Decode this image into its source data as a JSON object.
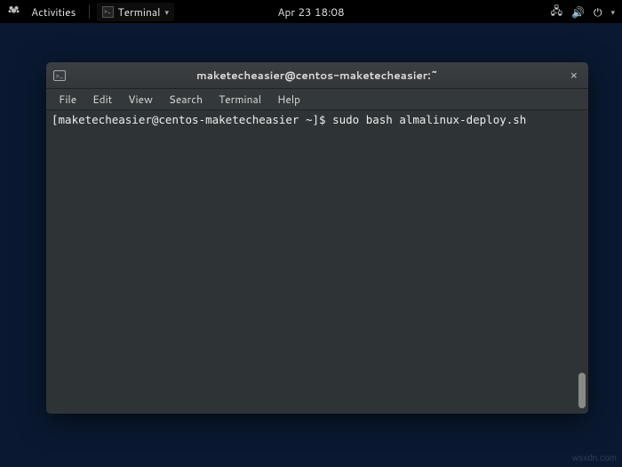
{
  "topbar": {
    "activities": "Activities",
    "app_name": "Terminal",
    "datetime": "Apr 23  18:08"
  },
  "icons": {
    "network": "🖧",
    "volume": "🔊",
    "power": "⏻",
    "dropdown": "▾",
    "terminal_prompt": ">_"
  },
  "window": {
    "title": "maketecheasier@centos-maketecheasier:~",
    "close_label": "×",
    "menu": {
      "file": "File",
      "edit": "Edit",
      "view": "View",
      "search": "Search",
      "terminal": "Terminal",
      "help": "Help"
    },
    "terminal": {
      "prompt": "[maketecheasier@centos-maketecheasier ~]$ ",
      "command": "sudo bash almalinux-deploy.sh"
    }
  },
  "watermark": "wsxdn.com"
}
